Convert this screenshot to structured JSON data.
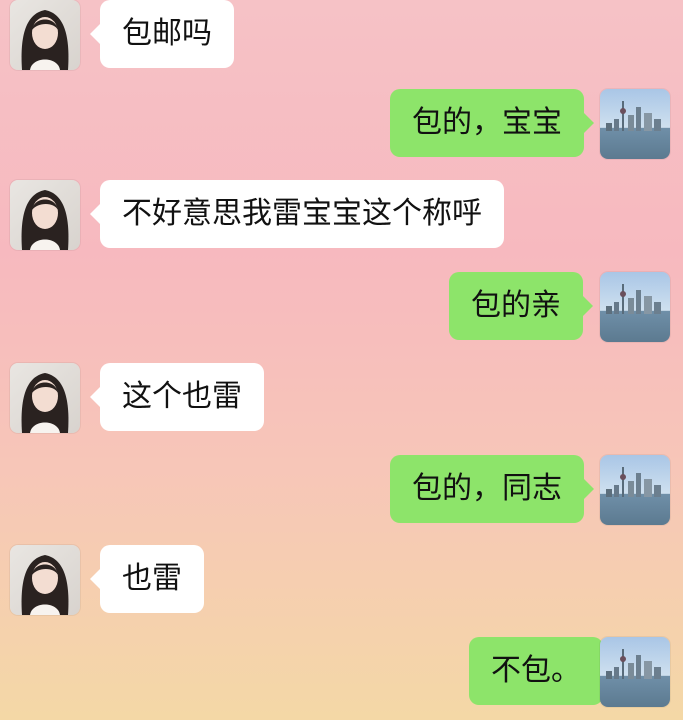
{
  "messages": [
    {
      "side": "in",
      "text": "包邮吗"
    },
    {
      "side": "out",
      "text": "包的，宝宝"
    },
    {
      "side": "in",
      "text": "不好意思我雷宝宝这个称呼"
    },
    {
      "side": "out",
      "text": "包的亲"
    },
    {
      "side": "in",
      "text": "这个也雷"
    },
    {
      "side": "out",
      "text": "包的，同志"
    },
    {
      "side": "in",
      "text": "也雷"
    },
    {
      "side": "out",
      "text": "不包。"
    }
  ],
  "colors": {
    "incoming_bubble": "#ffffff",
    "outgoing_bubble": "#8de46a"
  },
  "icons": {
    "incoming_avatar": "woman-avatar",
    "outgoing_avatar": "city-skyline-avatar"
  }
}
